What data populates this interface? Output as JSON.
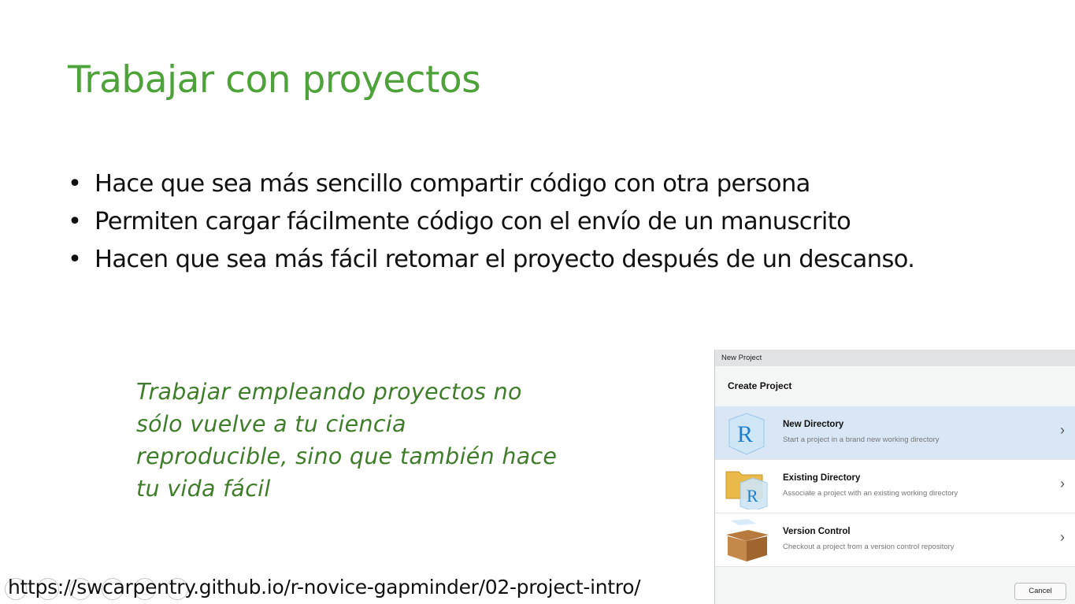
{
  "slide": {
    "title": "Trabajar con proyectos",
    "bullets": [
      "Hace que sea más sencillo compartir código con otra persona",
      "Permiten cargar fácilmente código con el envío de un manuscrito",
      "Hacen que sea más fácil retomar el proyecto después de un descanso."
    ],
    "quote": "Trabajar empleando proyectos no sólo vuelve a tu ciencia reproducible, sino que también hace tu vida fácil",
    "url": "https://swcarpentry.github.io/r-novice-gapminder/02-project-intro/"
  },
  "dialog": {
    "window_title": "New Project",
    "heading": "Create Project",
    "options": [
      {
        "name": "New Directory",
        "desc": "Start a project in a brand new working directory",
        "icon": "r-cube-icon",
        "selected": true
      },
      {
        "name": "Existing Directory",
        "desc": "Associate a project with an existing working directory",
        "icon": "folder-r-icon"
      },
      {
        "name": "Version Control",
        "desc": "Checkout a project from a version control repository",
        "icon": "box-icon"
      }
    ],
    "cancel": "Cancel"
  },
  "colors": {
    "title": "#4ea23a",
    "quote": "#3f7d2b",
    "selected": "#d9e6f6"
  }
}
